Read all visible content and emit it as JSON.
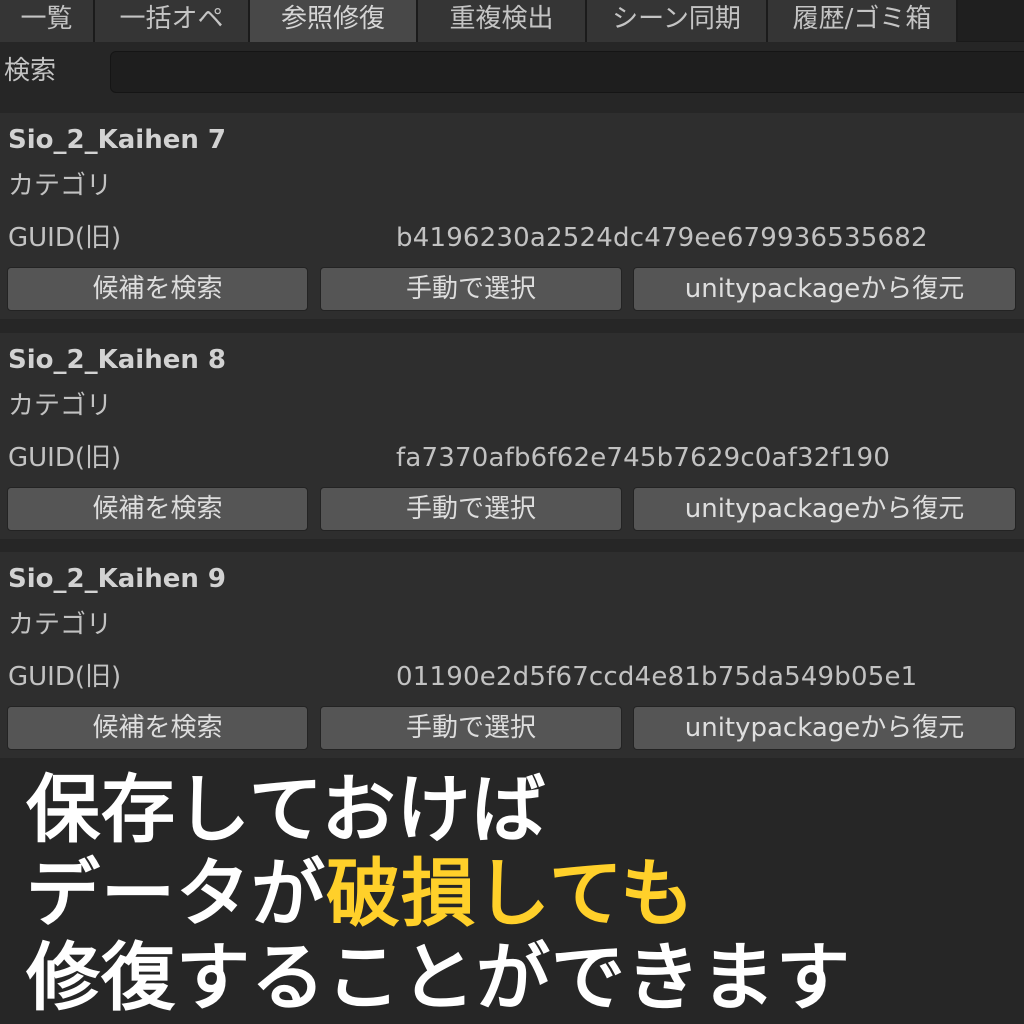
{
  "tabs": [
    {
      "label": "一覧"
    },
    {
      "label": "一括オペ"
    },
    {
      "label": "参照修復"
    },
    {
      "label": "重複検出"
    },
    {
      "label": "シーン同期"
    },
    {
      "label": "履歴/ゴミ箱"
    }
  ],
  "search": {
    "label": "検索",
    "value": "",
    "placeholder": ""
  },
  "entries": [
    {
      "name": "Sio_2_Kaihen 7",
      "category_label": "カテゴリ",
      "guid_label": "GUID(旧)",
      "guid_value": "b4196230a2524dc479ee679936535682",
      "btn_search": "候補を検索",
      "btn_manual": "手動で選択",
      "btn_restore": "unitypackageから復元"
    },
    {
      "name": "Sio_2_Kaihen 8",
      "category_label": "カテゴリ",
      "guid_label": "GUID(旧)",
      "guid_value": "fa7370afb6f62e745b7629c0af32f190",
      "btn_search": "候補を検索",
      "btn_manual": "手動で選択",
      "btn_restore": "unitypackageから復元"
    },
    {
      "name": "Sio_2_Kaihen 9",
      "category_label": "カテゴリ",
      "guid_label": "GUID(旧)",
      "guid_value": "01190e2d5f67ccd4e81b75da549b05e1",
      "btn_search": "候補を検索",
      "btn_manual": "手動で選択",
      "btn_restore": "unitypackageから復元"
    }
  ],
  "caption": {
    "line1": "保存しておけば",
    "line2_a": "データが",
    "line2_b": "破損しても",
    "line3": "修復することができます"
  },
  "colors": {
    "background": "#262626",
    "entry_background": "#2e2e2e",
    "button": "#555555",
    "active_tab": "#484848",
    "caption_text": "#ffffff",
    "caption_highlight": "#ffd02a"
  }
}
